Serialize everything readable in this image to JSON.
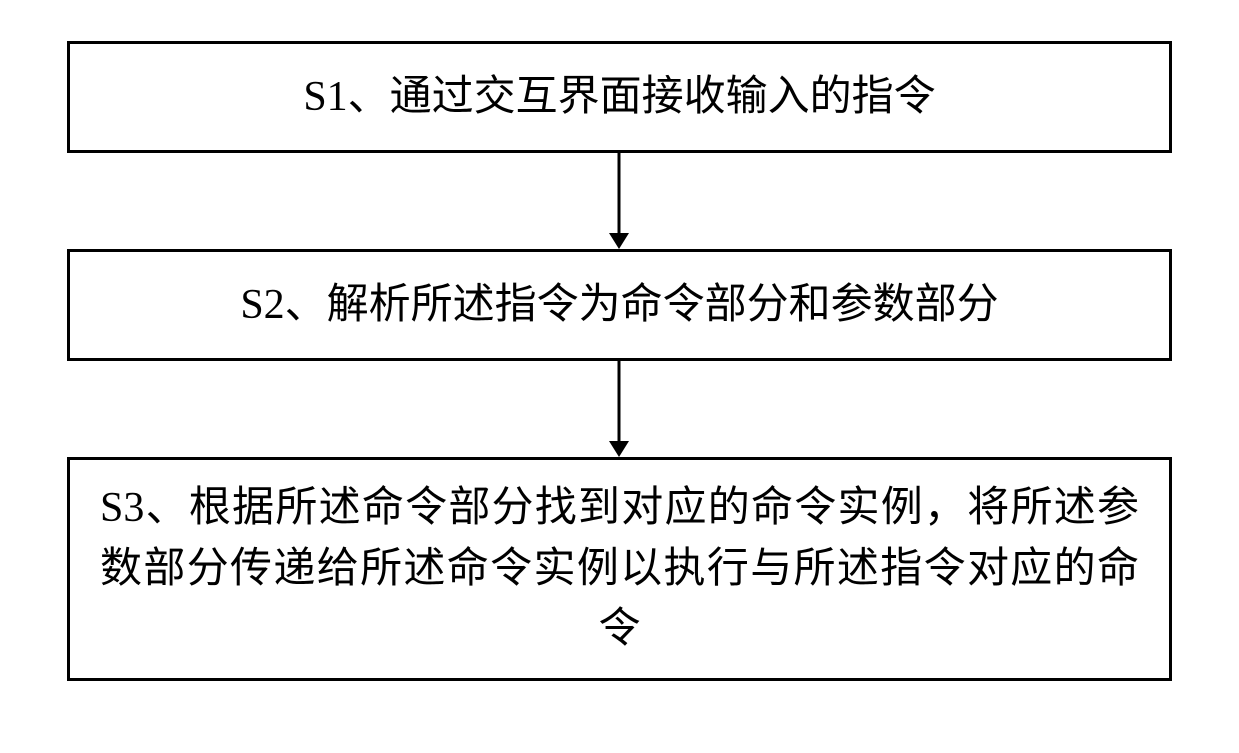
{
  "flow": {
    "steps": [
      {
        "id": "s1",
        "label": "S1、通过交互界面接收输入的指令"
      },
      {
        "id": "s2",
        "label": "S2、解析所述指令为命令部分和参数部分"
      },
      {
        "id": "s3",
        "label": "S3、根据所述命令部分找到对应的命令实例，将所述参数部分传递给所述命令实例以执行与所述指令对应的命令"
      }
    ],
    "arrows": [
      {
        "from": "s1",
        "to": "s2"
      },
      {
        "from": "s2",
        "to": "s3"
      }
    ]
  }
}
